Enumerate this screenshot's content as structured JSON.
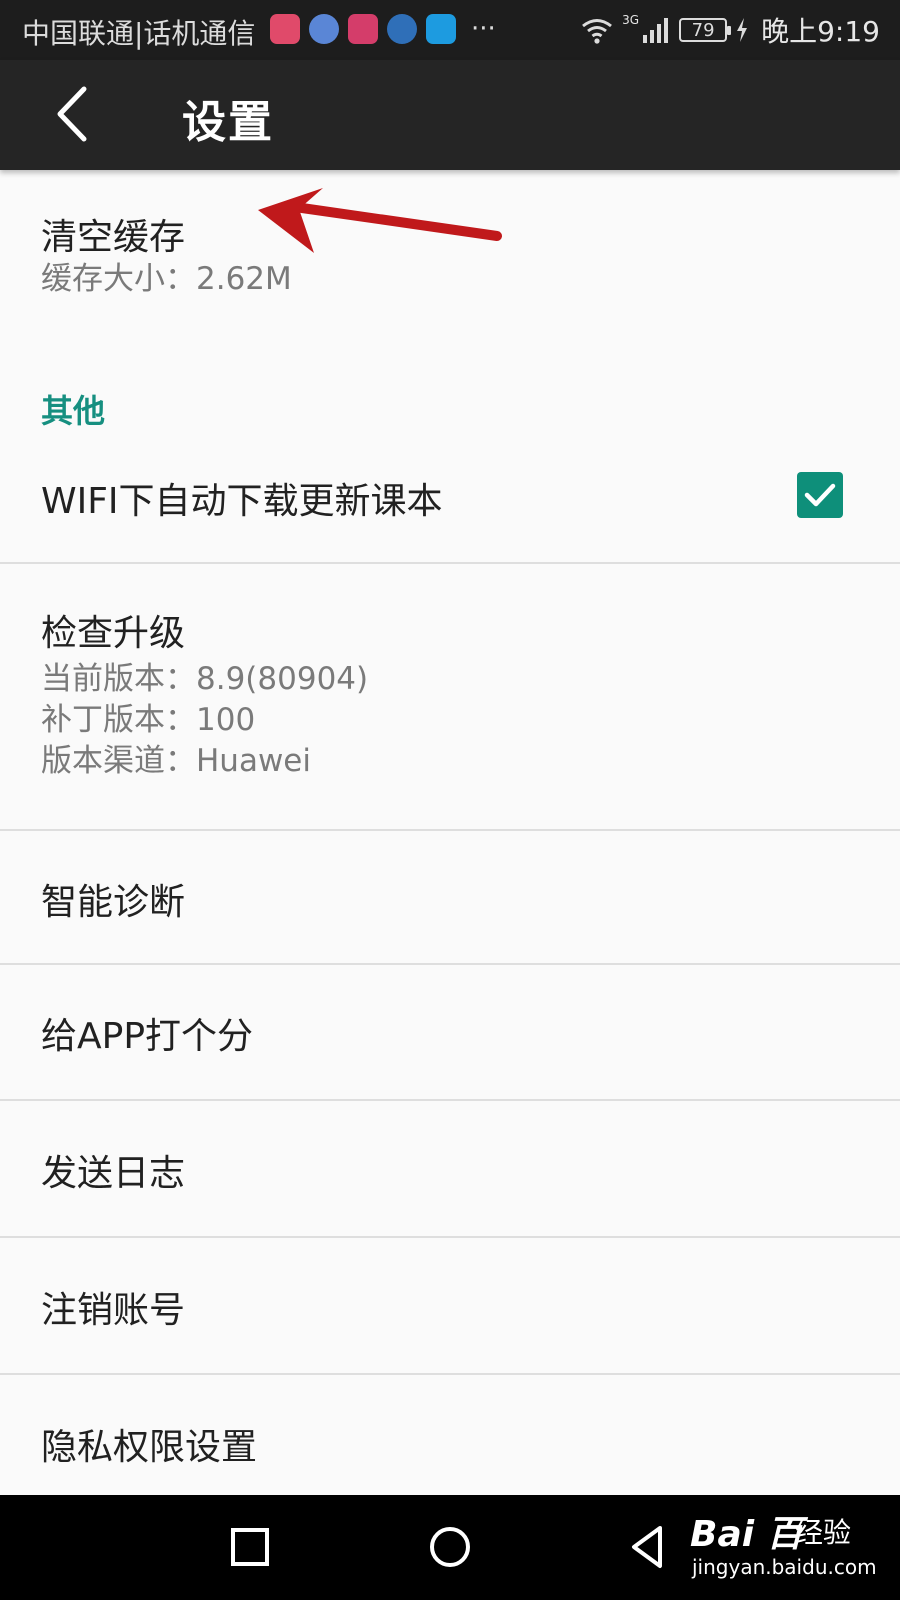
{
  "status_bar": {
    "carrier": "中国联通|话机通信",
    "more": "···",
    "network": "3G",
    "battery": "79",
    "time": "晚上9:19",
    "icons": [
      "notification-app-icon",
      "notification-app-icon",
      "notification-app-icon",
      "notification-app-icon",
      "notification-app-icon"
    ],
    "app_colors": [
      "#e04a6a",
      "#5a86d6",
      "#d43d6a",
      "#2f6fb8",
      "#1d9be0"
    ]
  },
  "toolbar": {
    "title": "设置"
  },
  "clear_cache": {
    "title": "清空缓存",
    "summary": "缓存大小：2.62M"
  },
  "category_other": "其他",
  "wifi_update": {
    "title": "WIFI下自动下载更新课本",
    "checked": true
  },
  "check_update": {
    "title": "检查升级",
    "current_version": "当前版本：8.9(80904)",
    "patch_version": "补丁版本：100",
    "channel": "版本渠道：Huawei"
  },
  "items": {
    "diagnosis": "智能诊断",
    "rate_app": "给APP打个分",
    "send_log": "发送日志",
    "logout": "注销账号",
    "privacy": "隐私权限设置"
  },
  "watermark": {
    "brand": "Bai 百",
    "suffix": "经验",
    "url": "jingyan.baidu.com"
  },
  "colors": {
    "accent": "#168f80",
    "checkbox": "#0e8f7a",
    "toolbar": "#252525",
    "annotation_arrow": "#c0191b"
  }
}
